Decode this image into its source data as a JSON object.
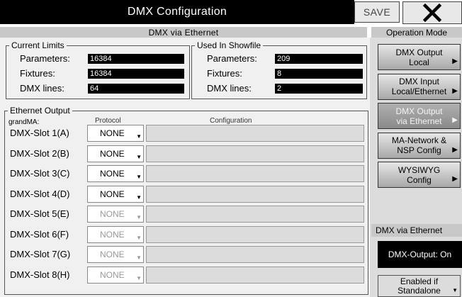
{
  "title": "DMX Configuration",
  "save_label": "SAVE",
  "close_glyph": "✕",
  "subheader": "DMX via Ethernet",
  "operation_mode_header": "Operation Mode",
  "current_limits": {
    "legend": "Current Limits",
    "rows": [
      {
        "label": "Parameters:",
        "value": "16384"
      },
      {
        "label": "Fixtures:",
        "value": "16384"
      },
      {
        "label": "DMX lines:",
        "value": "64"
      }
    ]
  },
  "used_in_showfile": {
    "legend": "Used In Showfile",
    "rows": [
      {
        "label": "Parameters:",
        "value": "209"
      },
      {
        "label": "Fixtures:",
        "value": "8"
      },
      {
        "label": "DMX  lines:",
        "value": "2"
      }
    ]
  },
  "ethernet_output": {
    "legend": "Ethernet Output",
    "sublabel": "grandMA:",
    "col_protocol": "Protocol",
    "col_configuration": "Configuration",
    "slots": [
      {
        "label": "DMX-Slot 1(A)",
        "protocol": "NONE",
        "enabled": true
      },
      {
        "label": "DMX-Slot 2(B)",
        "protocol": "NONE",
        "enabled": true
      },
      {
        "label": "DMX-Slot 3(C)",
        "protocol": "NONE",
        "enabled": true
      },
      {
        "label": "DMX-Slot 4(D)",
        "protocol": "NONE",
        "enabled": true
      },
      {
        "label": "DMX-Slot 5(E)",
        "protocol": "NONE",
        "enabled": false
      },
      {
        "label": "DMX-Slot 6(F)",
        "protocol": "NONE",
        "enabled": false
      },
      {
        "label": "DMX-Slot 7(G)",
        "protocol": "NONE",
        "enabled": false
      },
      {
        "label": "DMX-Slot 8(H)",
        "protocol": "NONE",
        "enabled": false
      }
    ]
  },
  "mode_buttons": [
    {
      "line1": "DMX Output",
      "line2": "Local",
      "active": false
    },
    {
      "line1": "DMX Input",
      "line2": "Local/Ethernet",
      "active": false
    },
    {
      "line1": "DMX Output",
      "line2": "via Ethernet",
      "active": true
    },
    {
      "line1": "MA-Network &",
      "line2": "NSP Config",
      "active": false
    },
    {
      "line1": "WYSIWYG",
      "line2": "Config",
      "active": false
    }
  ],
  "dmx_via_ethernet_header": "DMX via Ethernet",
  "dmx_output_status": "DMX-Output: On",
  "enabled_button": {
    "line1": "Enabled if",
    "line2": "Standalone"
  }
}
